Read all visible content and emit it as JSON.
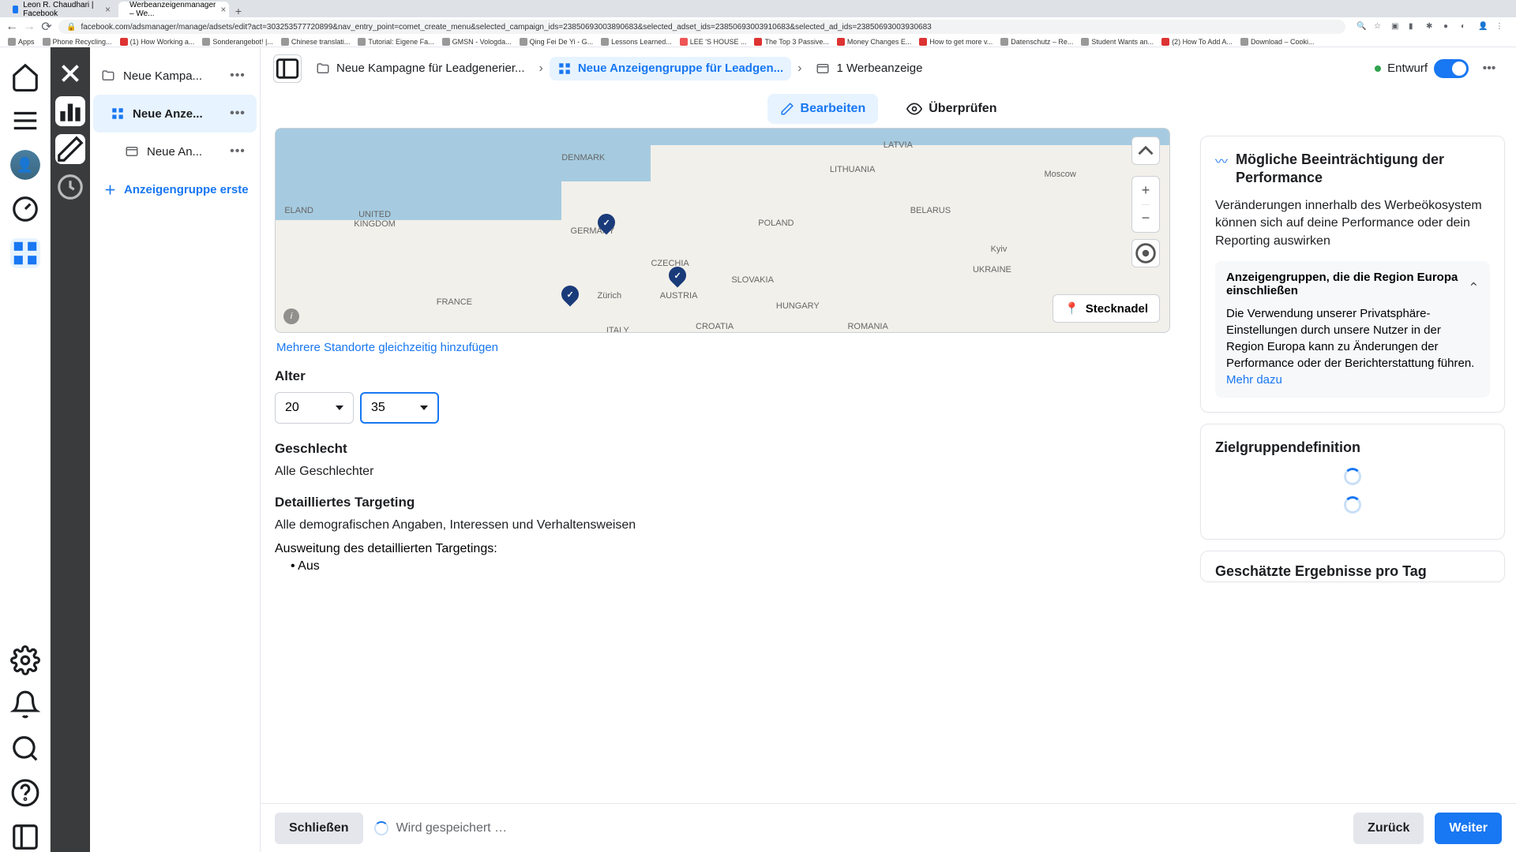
{
  "chrome": {
    "tabs": [
      {
        "title": "Leon R. Chaudhari | Facebook"
      },
      {
        "title": "Werbeanzeigenmanager – We..."
      }
    ],
    "url": "facebook.com/adsmanager/manage/adsets/edit?act=303253577720899&nav_entry_point=comet_create_menu&selected_campaign_ids=23850693003890683&selected_adset_ids=23850693003910683&selected_ad_ids=23850693003930683",
    "bookmarks": [
      "Apps",
      "Phone Recycling...",
      "(1) How Working a...",
      "Sonderangebot! |...",
      "Chinese translati...",
      "Tutorial: Eigene Fa...",
      "GMSN - Vologda...",
      "Qing Fei De Yi - G...",
      "Lessons Learned...",
      "LEE 'S HOUSE ...",
      "The Top 3 Passive...",
      "Money Changes E...",
      "How to get more v...",
      "Datenschutz – Re...",
      "Student Wants an...",
      "(2) How To Add A...",
      "Download – Cooki..."
    ]
  },
  "tree": {
    "campaign": "Neue Kampa...",
    "adset": "Neue Anze...",
    "ad": "Neue An...",
    "add": "Anzeigengruppe erste"
  },
  "breadcrumb": {
    "campaign": "Neue Kampagne für Leadgenerier...",
    "adset": "Neue Anzeigengruppe für Leadgen...",
    "ad": "1 Werbeanzeige",
    "status": "Entwurf"
  },
  "tabs": {
    "edit": "Bearbeiten",
    "review": "Überprüfen"
  },
  "map": {
    "labels": {
      "latvia": "LATVIA",
      "denmark": "DENMARK",
      "lithuania": "LITHUANIA",
      "moscow": "Moscow",
      "eland": "ELAND",
      "uk": "UNITED KINGDOM",
      "germany": "GERMANY",
      "poland": "POLAND",
      "belarus": "BELARUS",
      "czechia": "CZECHIA",
      "kyiv": "Kyiv",
      "zurich": "Zürich",
      "austria": "AUSTRIA",
      "slovakia": "SLOVAKIA",
      "ukraine": "UKRAINE",
      "france": "FRANCE",
      "hungary": "HUNGARY",
      "croatia": "CROATIA",
      "romania": "ROMANIA",
      "italy": "ITALY"
    },
    "pin_btn": "Stecknadel",
    "multi_link": "Mehrere Standorte gleichzeitig hinzufügen"
  },
  "form": {
    "age_label": "Alter",
    "age_min": "20",
    "age_max": "35",
    "gender_label": "Geschlecht",
    "gender_value": "Alle Geschlechter",
    "targeting_label": "Detailliertes Targeting",
    "targeting_value": "Alle demografischen Angaben, Interessen und Verhaltensweisen",
    "expansion_label": "Ausweitung des detaillierten Targetings:",
    "expansion_value": "Aus"
  },
  "right": {
    "perf_title": "Mögliche Beeinträchtigung der Performance",
    "perf_body": "Veränderungen innerhalb des Werbeökosystem können sich auf deine Performance oder dein Reporting auswirken",
    "info_hdr": "Anzeigengruppen, die die Region Europa einschließen",
    "info_body": "Die Verwendung unserer Privatsphäre-Einstellungen durch unsere Nutzer in der Region Europa kann zu Änderungen der Performance oder der Berichterstattung führen. ",
    "info_link": "Mehr dazu",
    "audience_title": "Zielgruppendefinition",
    "estimate_title": "Geschätzte Ergebnisse pro Tag"
  },
  "footer": {
    "close": "Schließen",
    "saving": "Wird gespeichert …",
    "back": "Zurück",
    "next": "Weiter"
  }
}
